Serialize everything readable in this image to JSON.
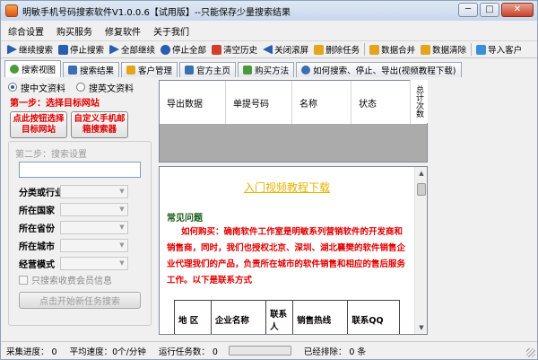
{
  "window": {
    "title": "明敏手机号码搜索软件V1.0.0.6【试用版】--只能保存少量搜索结果",
    "min_label": "─",
    "max_label": "□",
    "close_label": "✕"
  },
  "menu": [
    "综合设置",
    "购买服务",
    "修复软件",
    "关于我们"
  ],
  "toolbar": [
    {
      "label": "继续搜索",
      "icon": "play-icon",
      "color": "#2a5db0"
    },
    {
      "label": "停止搜索",
      "icon": "stop-icon",
      "color": "#2a5db0"
    },
    {
      "label": "全部继续",
      "icon": "play-all-icon",
      "color": "#2a5db0"
    },
    {
      "label": "停止全部",
      "icon": "stop-all-icon",
      "color": "#2a5db0"
    },
    {
      "label": "清空历史",
      "icon": "clear-history-icon",
      "color": "#d23f2f"
    },
    {
      "label": "关闭滚屏",
      "icon": "close-scroll-icon",
      "color": "#2a5db0"
    },
    {
      "label": "删除任务",
      "icon": "delete-task-icon",
      "color": "#e4a51c"
    },
    {
      "label": "数据合并",
      "icon": "merge-data-icon",
      "color": "#e4a51c"
    },
    {
      "label": "数据清除",
      "icon": "clear-data-icon",
      "color": "#e4a51c"
    },
    {
      "label": "导入客户",
      "icon": "import-customer-icon",
      "color": "#3a8fd8"
    }
  ],
  "tabs": [
    {
      "label": "搜索视图",
      "icon": "search-view-icon",
      "active": true
    },
    {
      "label": "搜索结果",
      "icon": "results-icon",
      "active": false
    },
    {
      "label": "客户管理",
      "icon": "customer-icon",
      "active": false
    },
    {
      "label": "官方主页",
      "icon": "homepage-icon",
      "active": false
    },
    {
      "label": "购买方法",
      "icon": "purchase-icon",
      "active": false
    },
    {
      "label": "如何搜索、停止、导出(视频教程下载)",
      "icon": "help-icon",
      "active": false
    }
  ],
  "left": {
    "radio_cn": "搜中文资料",
    "radio_en": "搜英文资料",
    "step1": "第一步：选择目标网站",
    "btn_target": "点此按钮选择目标网站",
    "btn_custom": "自定义手机邮箱搜索器",
    "step2": "第二步：搜索设置",
    "fields": [
      "分类或行业",
      "所在国家",
      "所在省份",
      "所在城市",
      "经营模式"
    ],
    "member_only": "只搜索收费会员信息",
    "start_btn": "点击开始新任务搜索"
  },
  "grid": {
    "columns": [
      "导出数据",
      "单提号码",
      "名称",
      "状态"
    ],
    "side_label": "总计次数"
  },
  "web": {
    "video_link": "入门视频教程下载",
    "faq_title": "常见问题",
    "faq_text": "如何购买：确南软件工作室是明敏系列营销软件的开发商和销售商，同时，我们也授权北京、深圳、湖北襄樊的软件销售企业代理我们的产品，负责所在城市的软件销售和相应的售后服务工作。以下是联系方式",
    "table_headers": [
      "地 区",
      "企业名称",
      "联系人",
      "销售热线",
      "联系QQ"
    ]
  },
  "status": {
    "progress_label": "采集进度： 0",
    "speed_label": "平均速度：0个/分钟",
    "tasks_label": "运行任务数： 0",
    "bar_value": 0,
    "done_label": "已经排除： 0  条"
  },
  "colors": {
    "accent_red": "#e00000",
    "link_yellow": "#e3b400"
  }
}
